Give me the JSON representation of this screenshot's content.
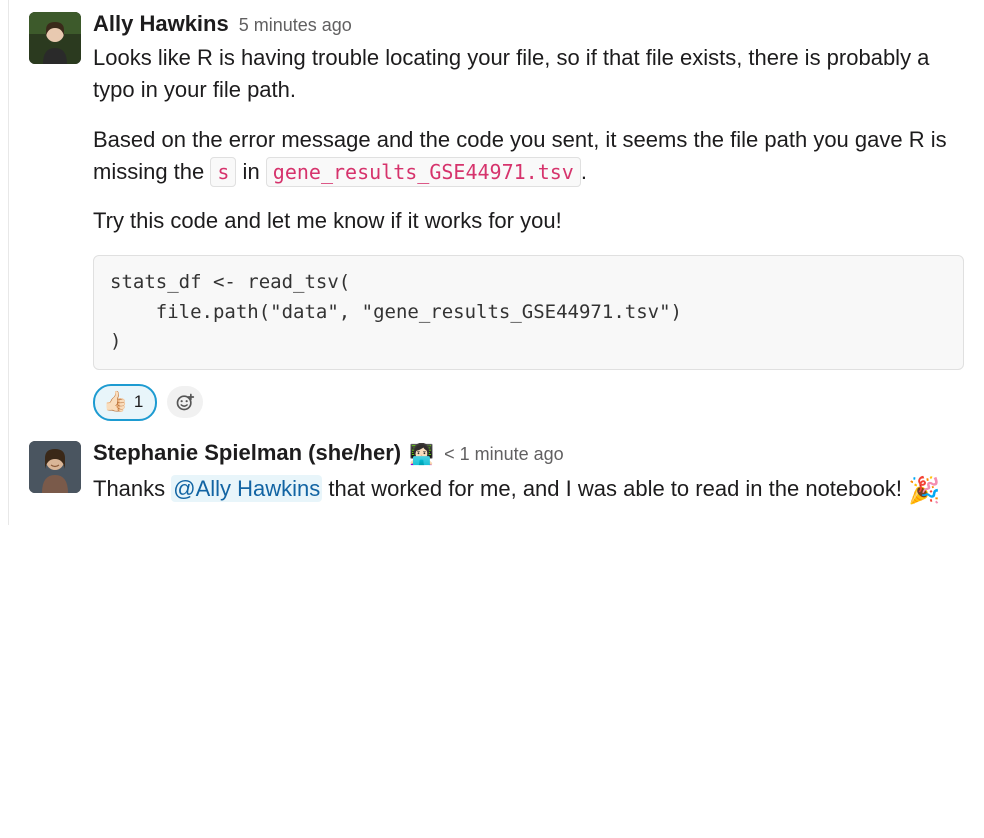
{
  "messages": [
    {
      "author": "Ally Hawkins",
      "timestamp": "5 minutes ago",
      "p1": "Looks like R is having trouble locating your file, so if that file exists, there is probably a typo in your file path.",
      "p2_a": "Based on the error message and the code you sent, it seems the file path you gave R is missing the ",
      "p2_code1": "s",
      "p2_b": " in ",
      "p2_code2": "gene_results_GSE44971.tsv",
      "p2_c": ".",
      "p3": "Try this code and let me know if it works for you!",
      "codeblock": "stats_df <- read_tsv(\n    file.path(\"data\", \"gene_results_GSE44971.tsv\")\n)",
      "reaction_emoji": "👍🏻",
      "reaction_count": "1"
    },
    {
      "author": "Stephanie Spielman (she/her)",
      "author_emoji": "👩🏻‍💻",
      "timestamp": "< 1 minute ago",
      "text_a": "Thanks ",
      "mention": "@Ally Hawkins",
      "text_b": " that worked for me, and I was able to read in the notebook! ",
      "party": "🎉"
    }
  ]
}
